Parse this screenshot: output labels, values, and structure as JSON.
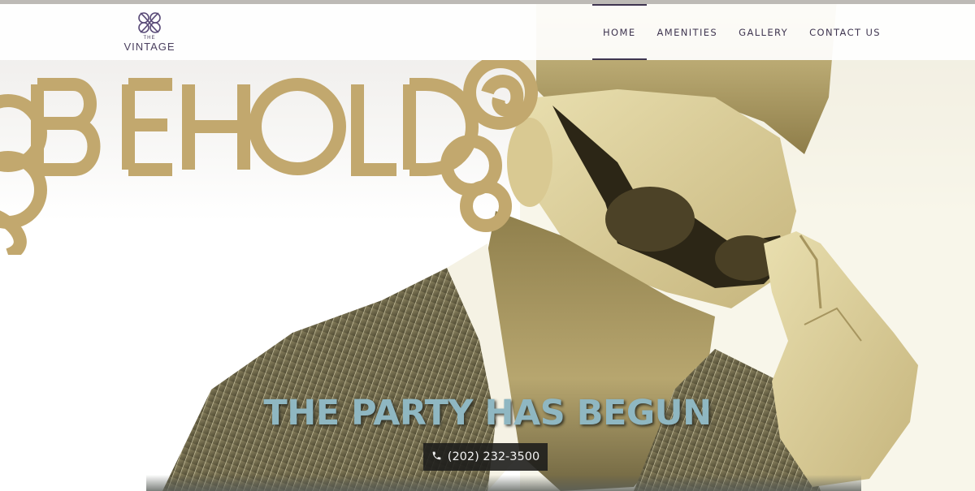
{
  "brand": {
    "logo_the": "THE",
    "logo_name": "VINTAGE"
  },
  "nav": {
    "items": [
      {
        "label": "HOME",
        "active": true
      },
      {
        "label": "AMENITIES",
        "active": false
      },
      {
        "label": "GALLERY",
        "active": false
      },
      {
        "label": "CONTACT US",
        "active": false
      }
    ]
  },
  "hero": {
    "headline_graphic": "BEHOLD",
    "tagline": "THE PARTY HAS BEGUN",
    "phone": "(202) 232-3500",
    "phone_icon": "phone-icon"
  },
  "colors": {
    "accent_gold": "#c2a86e",
    "nav_text": "#3f3550",
    "tagline": "#8fb7c2",
    "phone_bg": "#1e1e1c"
  }
}
